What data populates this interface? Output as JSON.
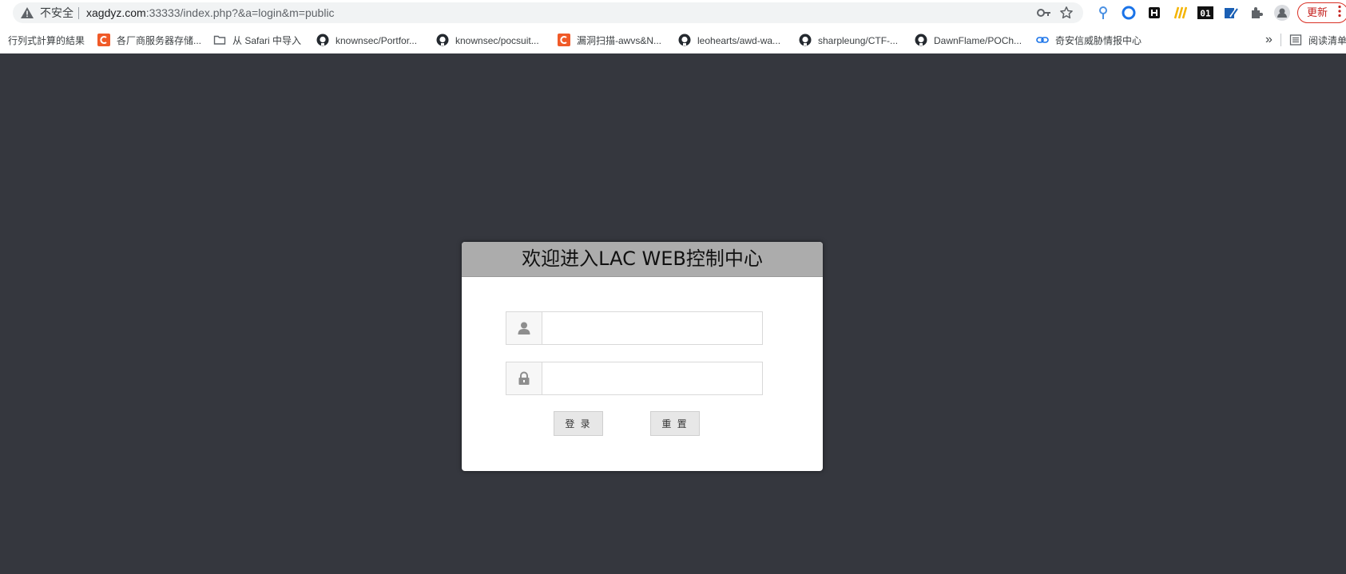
{
  "browser": {
    "security_label": "不安全",
    "url_host": "xagdyz.com",
    "url_rest": ":33333/index.php?&a=login&m=public",
    "update_label": "更新",
    "bookmarks": [
      {
        "label": "行列式計算的結果",
        "icon": "none"
      },
      {
        "label": "各厂商服务器存储...",
        "icon": "orange-c-icon"
      },
      {
        "label": "从 Safari 中导入",
        "icon": "folder-icon"
      },
      {
        "label": "knownsec/Portfor...",
        "icon": "github-icon"
      },
      {
        "label": "knownsec/pocsuit...",
        "icon": "github-icon"
      },
      {
        "label": "漏洞扫描-awvs&N...",
        "icon": "orange-c-icon"
      },
      {
        "label": "leohearts/awd-wa...",
        "icon": "github-icon"
      },
      {
        "label": "sharpleung/CTF-...",
        "icon": "github-icon"
      },
      {
        "label": "DawnFlame/POCh...",
        "icon": "github-icon"
      },
      {
        "label": "奇安信威胁情报中心",
        "icon": "link-icon"
      }
    ],
    "overflow_label": "»",
    "reading_list_label": "阅读清单"
  },
  "login": {
    "title": "欢迎进入LAC WEB控制中心",
    "username_value": "",
    "password_value": "",
    "login_label": "登 录",
    "reset_label": "重 置"
  },
  "colors": {
    "page_background": "#35373e",
    "header_background": "#acacac",
    "update_accent": "#d93025"
  }
}
